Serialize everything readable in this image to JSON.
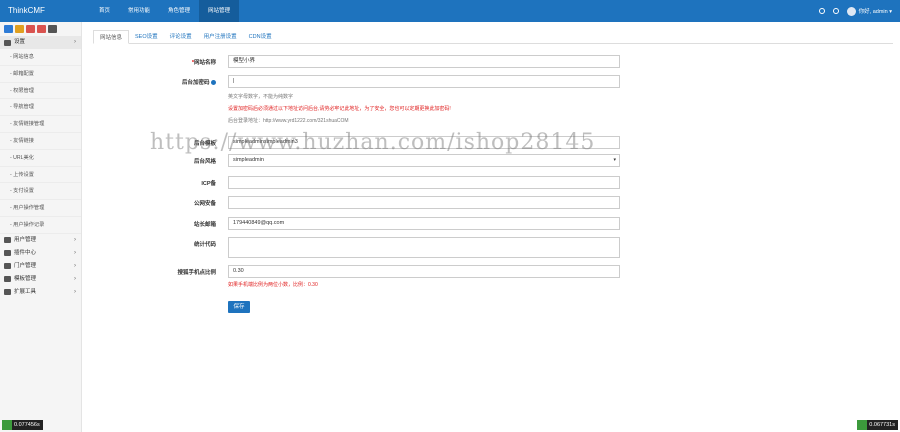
{
  "header": {
    "brand": "ThinkCMF",
    "nav": [
      "首页",
      "常用功能",
      "角色管理",
      "网站管理"
    ],
    "active_nav": 3,
    "user_label": "你好, admin ▾",
    "accent": "#1e73be"
  },
  "sidebar": {
    "quick_button_colors": [
      "#2d7bd6",
      "#e0a020",
      "#d9534f",
      "#d9534f",
      "#555555"
    ],
    "setting_group": "设置",
    "setting_items": [
      "网站信息",
      "邮箱配置",
      "权限管理",
      "导航管理",
      "友情链接管理",
      "友情链接",
      "URL美化",
      "上传设置",
      "支付设置",
      "用户操作管理",
      "用户操作记录"
    ],
    "groups": [
      "用户管理",
      "插件中心",
      "门户管理",
      "模板管理",
      "扩展工具"
    ]
  },
  "tabs": [
    "网站信息",
    "SEO设置",
    "评论设置",
    "用户注册设置",
    "CDN设置"
  ],
  "form": {
    "site_name_label": "网站名称",
    "site_name_value": "模型小界",
    "admin_entry_label": "后台加密码",
    "admin_entry_help_1": "英文字母数字，不能为纯数字",
    "admin_entry_help_2": "设置加密码后必须通过以下地址访问后台,请劳必牢记此地址，为了安全，您也可以定期更换此加密码!",
    "admin_entry_help_3": "后台登录地址：http://www.yrd1222.com/321shuaCOM",
    "admin_theme_label": "后台模板",
    "admin_theme_value": "simpleadminsimpleadmin3",
    "admin_style_label": "后台风格",
    "admin_style_value": "simpleadmin",
    "icp_label": "ICP备",
    "icp_value": "",
    "police_label": "公网安备",
    "police_value": "",
    "email_label": "站长邮箱",
    "email_value": "179440849@qq.com",
    "stats_label": "统计代码",
    "stats_value": "",
    "ratio_label": "搜狐手机点比例",
    "ratio_value": "0.30",
    "ratio_help": "如果手机端比例为两位小数，比例：0.30",
    "save_label": "保存"
  },
  "watermark": "https://www.huzhan.com/ishop28145",
  "footer": {
    "left_counter": "0.077456s",
    "right_counter": "0.067731s"
  }
}
